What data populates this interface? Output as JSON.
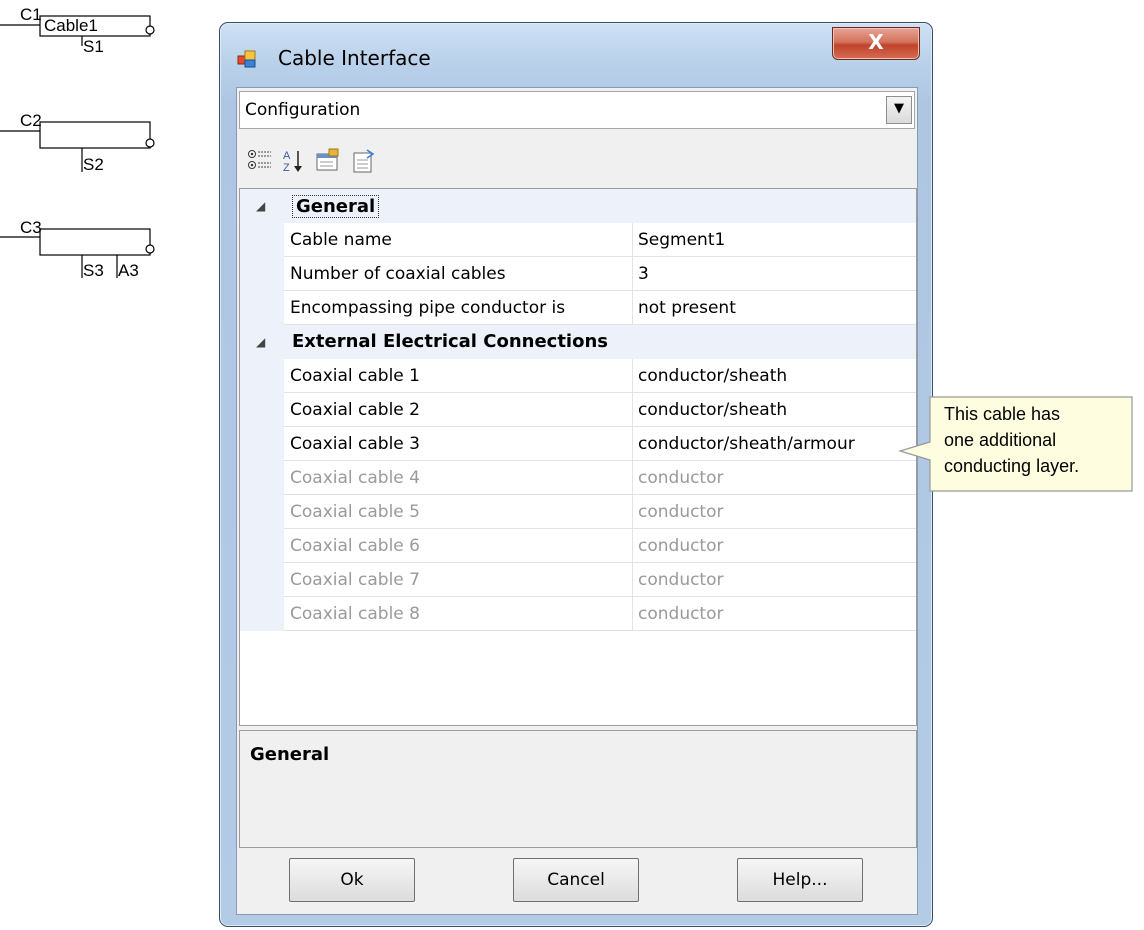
{
  "schematic": {
    "c1": {
      "label": "C1",
      "name": "Cable1",
      "bottom": "S1"
    },
    "c2": {
      "label": "C2",
      "bottom": "S2"
    },
    "c3": {
      "label": "C3",
      "bottom1": "S3",
      "bottom2": "A3"
    }
  },
  "window": {
    "title": "Cable Interface",
    "close_label": "X"
  },
  "combo": {
    "value": "Configuration"
  },
  "toolbar": {
    "icons": [
      "categorized-icon",
      "alphabetical-icon",
      "property-pages-icon",
      "events-icon"
    ]
  },
  "grid": {
    "general": {
      "label": "General",
      "rows": [
        {
          "name": "Cable name",
          "value": "Segment1"
        },
        {
          "name": "Number of coaxial cables",
          "value": "3"
        },
        {
          "name": "Encompassing pipe conductor is",
          "value": "not present"
        }
      ]
    },
    "external": {
      "label": "External Electrical Connections",
      "rows": [
        {
          "name": "Coaxial cable 1",
          "value": "conductor/sheath"
        },
        {
          "name": "Coaxial cable 2",
          "value": "conductor/sheath"
        },
        {
          "name": "Coaxial cable 3",
          "value": "conductor/sheath/armour"
        },
        {
          "name": "Coaxial cable 4",
          "value": "conductor"
        },
        {
          "name": "Coaxial cable 5",
          "value": "conductor"
        },
        {
          "name": "Coaxial cable 6",
          "value": "conductor"
        },
        {
          "name": "Coaxial cable 7",
          "value": "conductor"
        },
        {
          "name": "Coaxial cable 8",
          "value": "conductor"
        }
      ]
    }
  },
  "description": {
    "title": "General"
  },
  "buttons": {
    "ok": "Ok",
    "cancel": "Cancel",
    "help": "Help..."
  },
  "callout": {
    "line1": "This cable has",
    "line2": "one additional",
    "line3": "conducting layer."
  }
}
